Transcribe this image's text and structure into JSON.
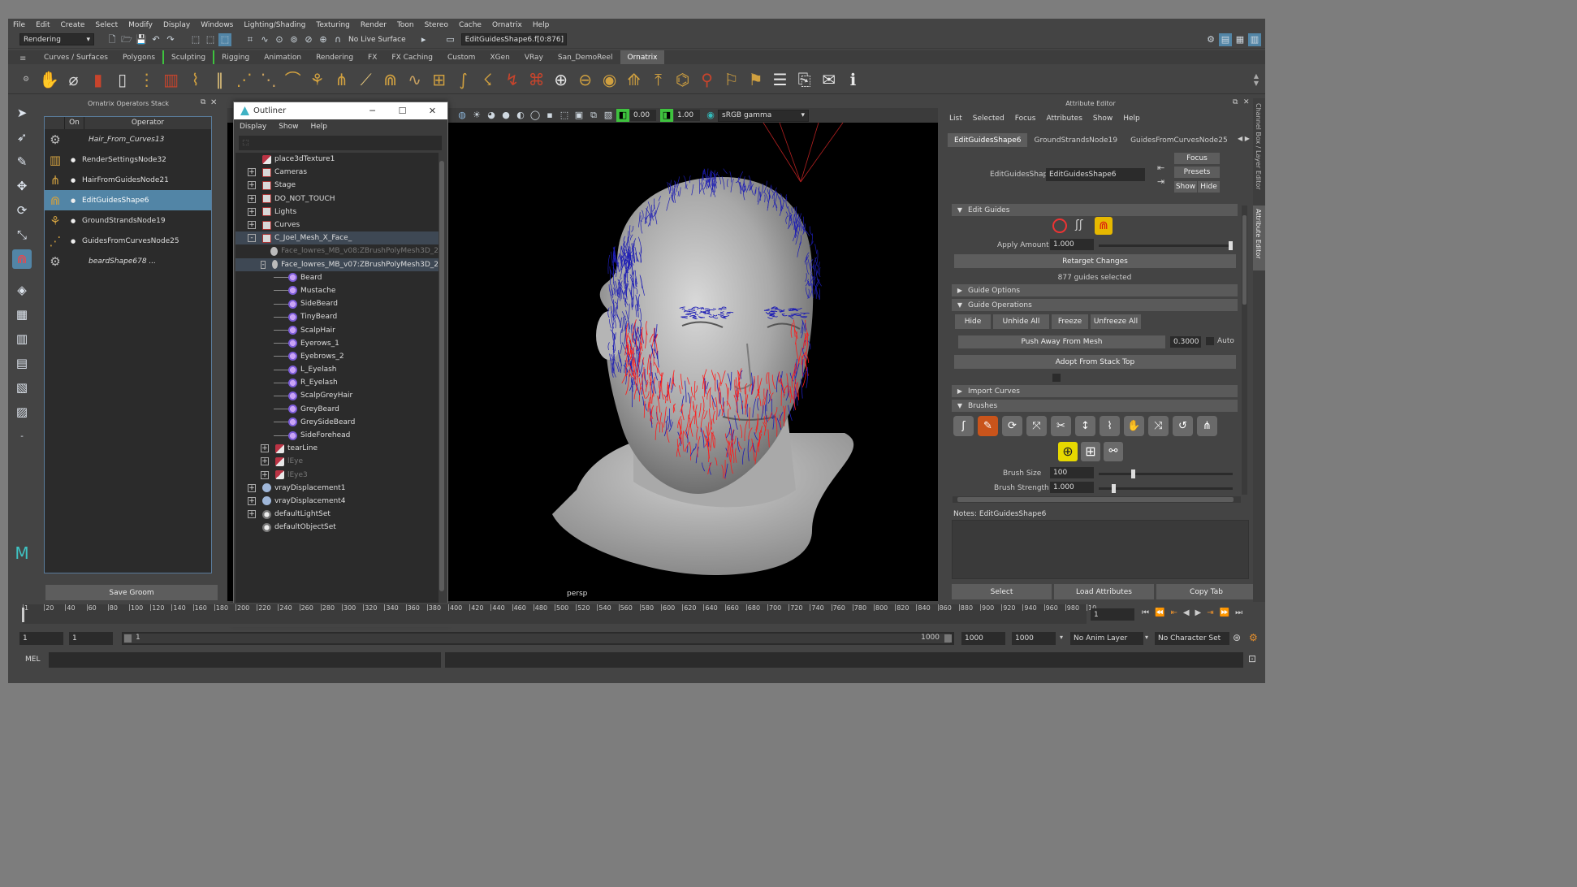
{
  "menubar": [
    "File",
    "Edit",
    "Create",
    "Select",
    "Modify",
    "Display",
    "Windows",
    "Lighting/Shading",
    "Texturing",
    "Render",
    "Toon",
    "Stereo",
    "Cache",
    "Ornatrix",
    "Help"
  ],
  "statusline": {
    "menuset": "Rendering",
    "live_surface": "No Live Surface",
    "selection_field": "EditGuidesShape6.f[0:876]"
  },
  "shelf_tabs": [
    "Curves / Surfaces",
    "Polygons",
    "Sculpting",
    "Rigging",
    "Animation",
    "Rendering",
    "FX",
    "FX Caching",
    "Custom",
    "XGen",
    "VRay",
    "San_DemoReel",
    "Ornatrix"
  ],
  "shelf_active": "Ornatrix",
  "stack": {
    "title": "Ornatrix Operators Stack",
    "col_on": "On",
    "col_operator": "Operator",
    "items": [
      {
        "label": "Hair_From_Curves13",
        "italic": true
      },
      {
        "label": "RenderSettingsNode32"
      },
      {
        "label": "HairFromGuidesNode21"
      },
      {
        "label": "EditGuidesShape6",
        "selected": true
      },
      {
        "label": "GroundStrandsNode19"
      },
      {
        "label": "GuidesFromCurvesNode25"
      },
      {
        "label": "beardShape678 ...",
        "italic": true
      }
    ],
    "save_button": "Save Groom"
  },
  "viewport": {
    "exposure": "0.00",
    "gamma": "1.00",
    "colorspace": "sRGB gamma",
    "camera_label": "persp",
    "guide_colors": {
      "selected": "#ff1a1a",
      "unselected": "#1d1db4",
      "mesh": "#b8b8b8"
    }
  },
  "outliner": {
    "title": "Outliner",
    "menu": [
      "Display",
      "Show",
      "Help"
    ],
    "rows": [
      {
        "label": "place3dTexture1",
        "depth": 0,
        "icon": "tex",
        "exp": ""
      },
      {
        "label": "Cameras",
        "depth": 0,
        "icon": "grp",
        "exp": "+"
      },
      {
        "label": "Stage",
        "depth": 0,
        "icon": "grp",
        "exp": "+"
      },
      {
        "label": "DO_NOT_TOUCH",
        "depth": 0,
        "icon": "grp",
        "exp": "+"
      },
      {
        "label": "Lights",
        "depth": 0,
        "icon": "grp",
        "exp": "+"
      },
      {
        "label": "Curves",
        "depth": 0,
        "icon": "grp",
        "exp": "+"
      },
      {
        "label": "C_Joel_Mesh_X_Face_",
        "depth": 0,
        "icon": "grp",
        "exp": "-",
        "selected": true
      },
      {
        "label": "Face_lowres_MB_v08:ZBrushPolyMesh3D_2",
        "depth": 1,
        "icon": "mesh",
        "exp": "",
        "dim": true
      },
      {
        "label": "Face_lowres_MB_v07:ZBrushPolyMesh3D_2",
        "depth": 1,
        "icon": "mesh",
        "exp": "-",
        "selected": true
      },
      {
        "label": "Beard",
        "depth": 2,
        "icon": "hair",
        "exp": ""
      },
      {
        "label": "Mustache",
        "depth": 2,
        "icon": "hair",
        "exp": ""
      },
      {
        "label": "SideBeard",
        "depth": 2,
        "icon": "hair",
        "exp": ""
      },
      {
        "label": "TinyBeard",
        "depth": 2,
        "icon": "hair",
        "exp": ""
      },
      {
        "label": "ScalpHair",
        "depth": 2,
        "icon": "hair",
        "exp": ""
      },
      {
        "label": "Eyerows_1",
        "depth": 2,
        "icon": "hair",
        "exp": ""
      },
      {
        "label": "Eyebrows_2",
        "depth": 2,
        "icon": "hair",
        "exp": ""
      },
      {
        "label": "L_Eyelash",
        "depth": 2,
        "icon": "hair",
        "exp": ""
      },
      {
        "label": "R_Eyelash",
        "depth": 2,
        "icon": "hair",
        "exp": ""
      },
      {
        "label": "ScalpGreyHair",
        "depth": 2,
        "icon": "hair",
        "exp": ""
      },
      {
        "label": "GreyBeard",
        "depth": 2,
        "icon": "hair",
        "exp": ""
      },
      {
        "label": "GreySideBeard",
        "depth": 2,
        "icon": "hair",
        "exp": ""
      },
      {
        "label": "SideForehead",
        "depth": 2,
        "icon": "hair",
        "exp": ""
      },
      {
        "label": "tearLine",
        "depth": 1,
        "icon": "tex",
        "exp": "+"
      },
      {
        "label": "lEye",
        "depth": 1,
        "icon": "tex",
        "exp": "+",
        "dim": true
      },
      {
        "label": "lEye3",
        "depth": 1,
        "icon": "tex",
        "exp": "+",
        "dim": true
      },
      {
        "label": "vrayDisplacement1",
        "depth": 0,
        "icon": "vray",
        "exp": "+"
      },
      {
        "label": "vrayDisplacement4",
        "depth": 0,
        "icon": "vray",
        "exp": "+"
      },
      {
        "label": "defaultLightSet",
        "depth": 0,
        "icon": "set",
        "exp": "+"
      },
      {
        "label": "defaultObjectSet",
        "depth": 0,
        "icon": "set",
        "exp": ""
      }
    ]
  },
  "attribute_editor": {
    "title": "Attribute Editor",
    "menu": [
      "List",
      "Selected",
      "Focus",
      "Attributes",
      "Show",
      "Help"
    ],
    "tabs": [
      "EditGuidesShape6",
      "GroundStrandsNode19",
      "GuidesFromCurvesNode25"
    ],
    "shape_label": "EditGuidesShape:",
    "shape_value": "EditGuidesShape6",
    "focus": "Focus",
    "presets": "Presets",
    "show": "Show",
    "hide": "Hide",
    "sections": {
      "edit_guides": "Edit Guides",
      "guide_options": "Guide Options",
      "guide_operations": "Guide Operations",
      "import_curves": "Import Curves",
      "brushes": "Brushes"
    },
    "apply_amount_label": "Apply Amount",
    "apply_amount": "1.000",
    "apply_amount_fraction": 1.0,
    "retarget": "Retarget Changes",
    "guides_selected": "877 guides selected",
    "ops_buttons": [
      "Hide",
      "Unhide All",
      "Freeze",
      "Unfreeze All"
    ],
    "push_away": "Push Away From Mesh",
    "push_value": "0.3000",
    "auto": "Auto",
    "adopt": "Adopt From Stack Top",
    "brush_size_label": "Brush Size",
    "brush_size": "100",
    "brush_size_fraction": 0.25,
    "brush_strength_label": "Brush Strength",
    "brush_strength": "1.000",
    "brush_strength_fraction": 0.1,
    "notes_label": "Notes:  EditGuidesShape6",
    "bottom_buttons": [
      "Select",
      "Load Attributes",
      "Copy Tab"
    ]
  },
  "side_tabs": [
    "Channel Box / Layer Editor",
    "Attribute Editor"
  ],
  "timeslider": {
    "ticks": [
      "1",
      "20",
      "40",
      "60",
      "80",
      "100",
      "120",
      "140",
      "160",
      "180",
      "200",
      "220",
      "240",
      "260",
      "280",
      "300",
      "320",
      "340",
      "360",
      "380",
      "400",
      "420",
      "440",
      "460",
      "480",
      "500",
      "520",
      "540",
      "560",
      "580",
      "600",
      "620",
      "640",
      "660",
      "680",
      "700",
      "720",
      "740",
      "760",
      "780",
      "800",
      "820",
      "840",
      "860",
      "880",
      "900",
      "920",
      "940",
      "960",
      "980",
      "10"
    ],
    "current_frame": "1"
  },
  "range": {
    "start": "1",
    "anim_start": "1",
    "slider_start": "1",
    "slider_end": "1000",
    "anim_end": "1000",
    "end": "1000",
    "anim_layer": "No Anim Layer",
    "character_set": "No Character Set"
  },
  "cmdline": {
    "label": "MEL"
  }
}
